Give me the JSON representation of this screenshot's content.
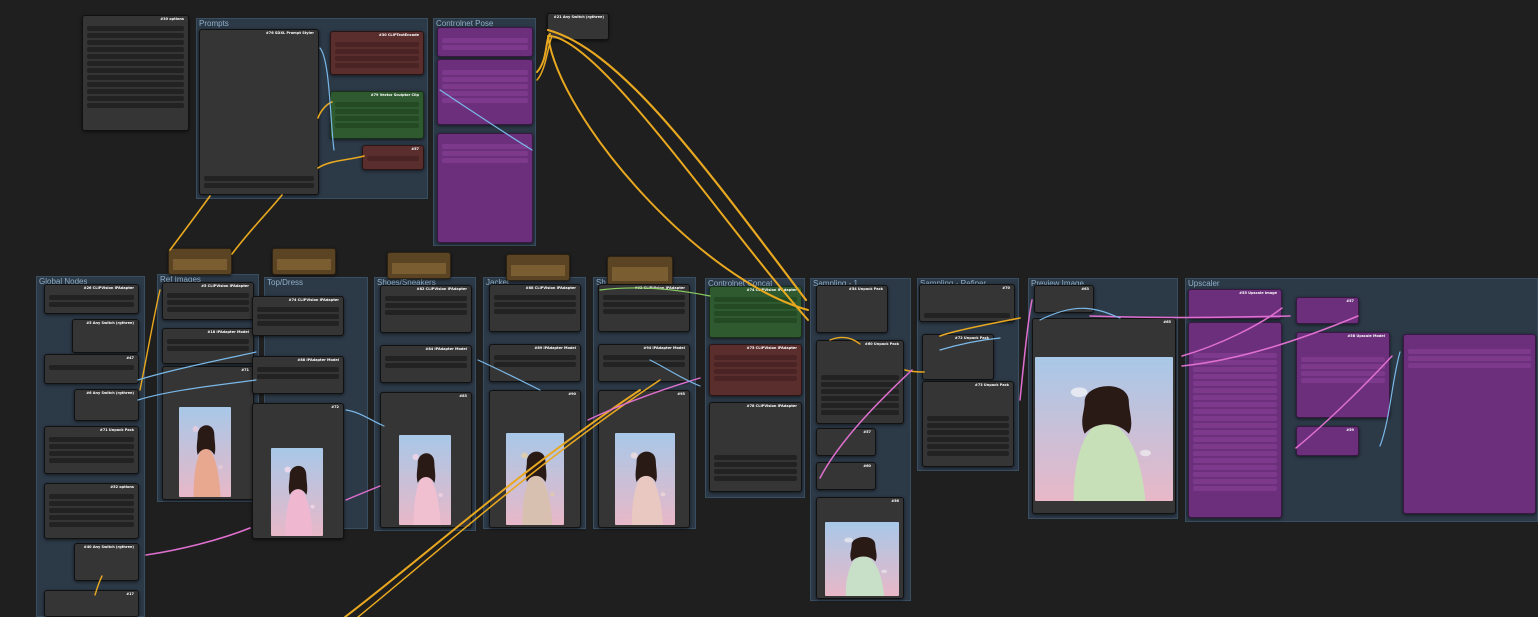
{
  "groups": {
    "prompts": "Prompts",
    "controlnet_pose": "Controlnet Pose",
    "global_nodes": "Global Nodes",
    "ref_images": "Ref Images",
    "top_dress": "Top/Dress",
    "shoes_sneakers": "Shoes/Sneakers",
    "jacket": "Jacket",
    "shoes2": "Sh",
    "controlnet_concat": "Controlnet Concat",
    "sampling_1": "Sampling - 1",
    "sampling_refiner": "Sampling - Refiner",
    "preview_image": "Preview Image",
    "upscaler": "Upscaler"
  },
  "nodes": {
    "options": "#30 options",
    "sdxl_prompt_styler": "#76 SDXL Prompt Styler",
    "clip_text": "#30 CLIPTextEncode",
    "vector_sculptor": "#79 Vector Sculptor Clip",
    "n57": "#57",
    "any_switch": "#21 Any Switch (rgthree)",
    "ipadapter_1": "#26 CLIPVision IPAdapter",
    "any_switch_2": "#5 Any Switch (rgthree)",
    "global_47": "#47",
    "any_switch_3": "#6 Any Switch (rgthree)",
    "unpack_1": "#71 Unpack Pack",
    "options_2": "#52 options",
    "any_switch_4": "#40 Any Switch (rgthree)",
    "n17": "#17",
    "ref_ipadapter": "#5 CLIPVision IPAdapter",
    "ref_vision": "#18 IPAdapter Model",
    "ref_71": "#71",
    "top_ipadapter": "#74 CLIPVision IPAdapter",
    "top_vision": "#88 IPAdapter Model",
    "top_72": "#72",
    "shoes_ipadapter": "#82 CLIPVision IPAdapter",
    "shoes_vision": "#84 IPAdapter Model",
    "shoes_83": "#83",
    "jacket_ipadapter": "#88 CLIPVision IPAdapter",
    "jacket_vision": "#89 IPAdapter Model",
    "jacket_90": "#90",
    "sh_ipadapter": "#93 CLIPVision IPAdapter",
    "sh_vision": "#94 IPAdapter Model",
    "sh_95": "#95",
    "cnet_1": "#74 CLIPVision IPAdapter",
    "cnet_2": "#75 CLIPVision IPAdapter",
    "cnet_3": "#78 CLIPVision IPAdapter",
    "unpack_2": "#54 Unpack Pack",
    "unpack_3": "#60 Unpack Pack",
    "n57b": "#57",
    "n60": "#60",
    "n56": "#56",
    "refiner_70": "#70",
    "refiner_unpack_1": "#72 Unpack Pack",
    "refiner_unpack_2": "#73 Unpack Pack",
    "preview_63": "#63",
    "preview_65": "#65",
    "upscale_1": "#55 Upscale Image",
    "upscale_2": "#57",
    "upscale_3": "#58 Upscale Model",
    "upscale_4": "#59"
  },
  "colors": {
    "group_bg": "#2c3947",
    "node_bg": "#353535",
    "green": "#2f5a2f",
    "red": "#5b2e2e",
    "purple": "#6b2f7b",
    "brown": "#5a4423",
    "wire_yellow": "#e8a820",
    "wire_pink": "#e070d0",
    "wire_blue": "#7ab8e8",
    "wire_green": "#8ad060"
  }
}
